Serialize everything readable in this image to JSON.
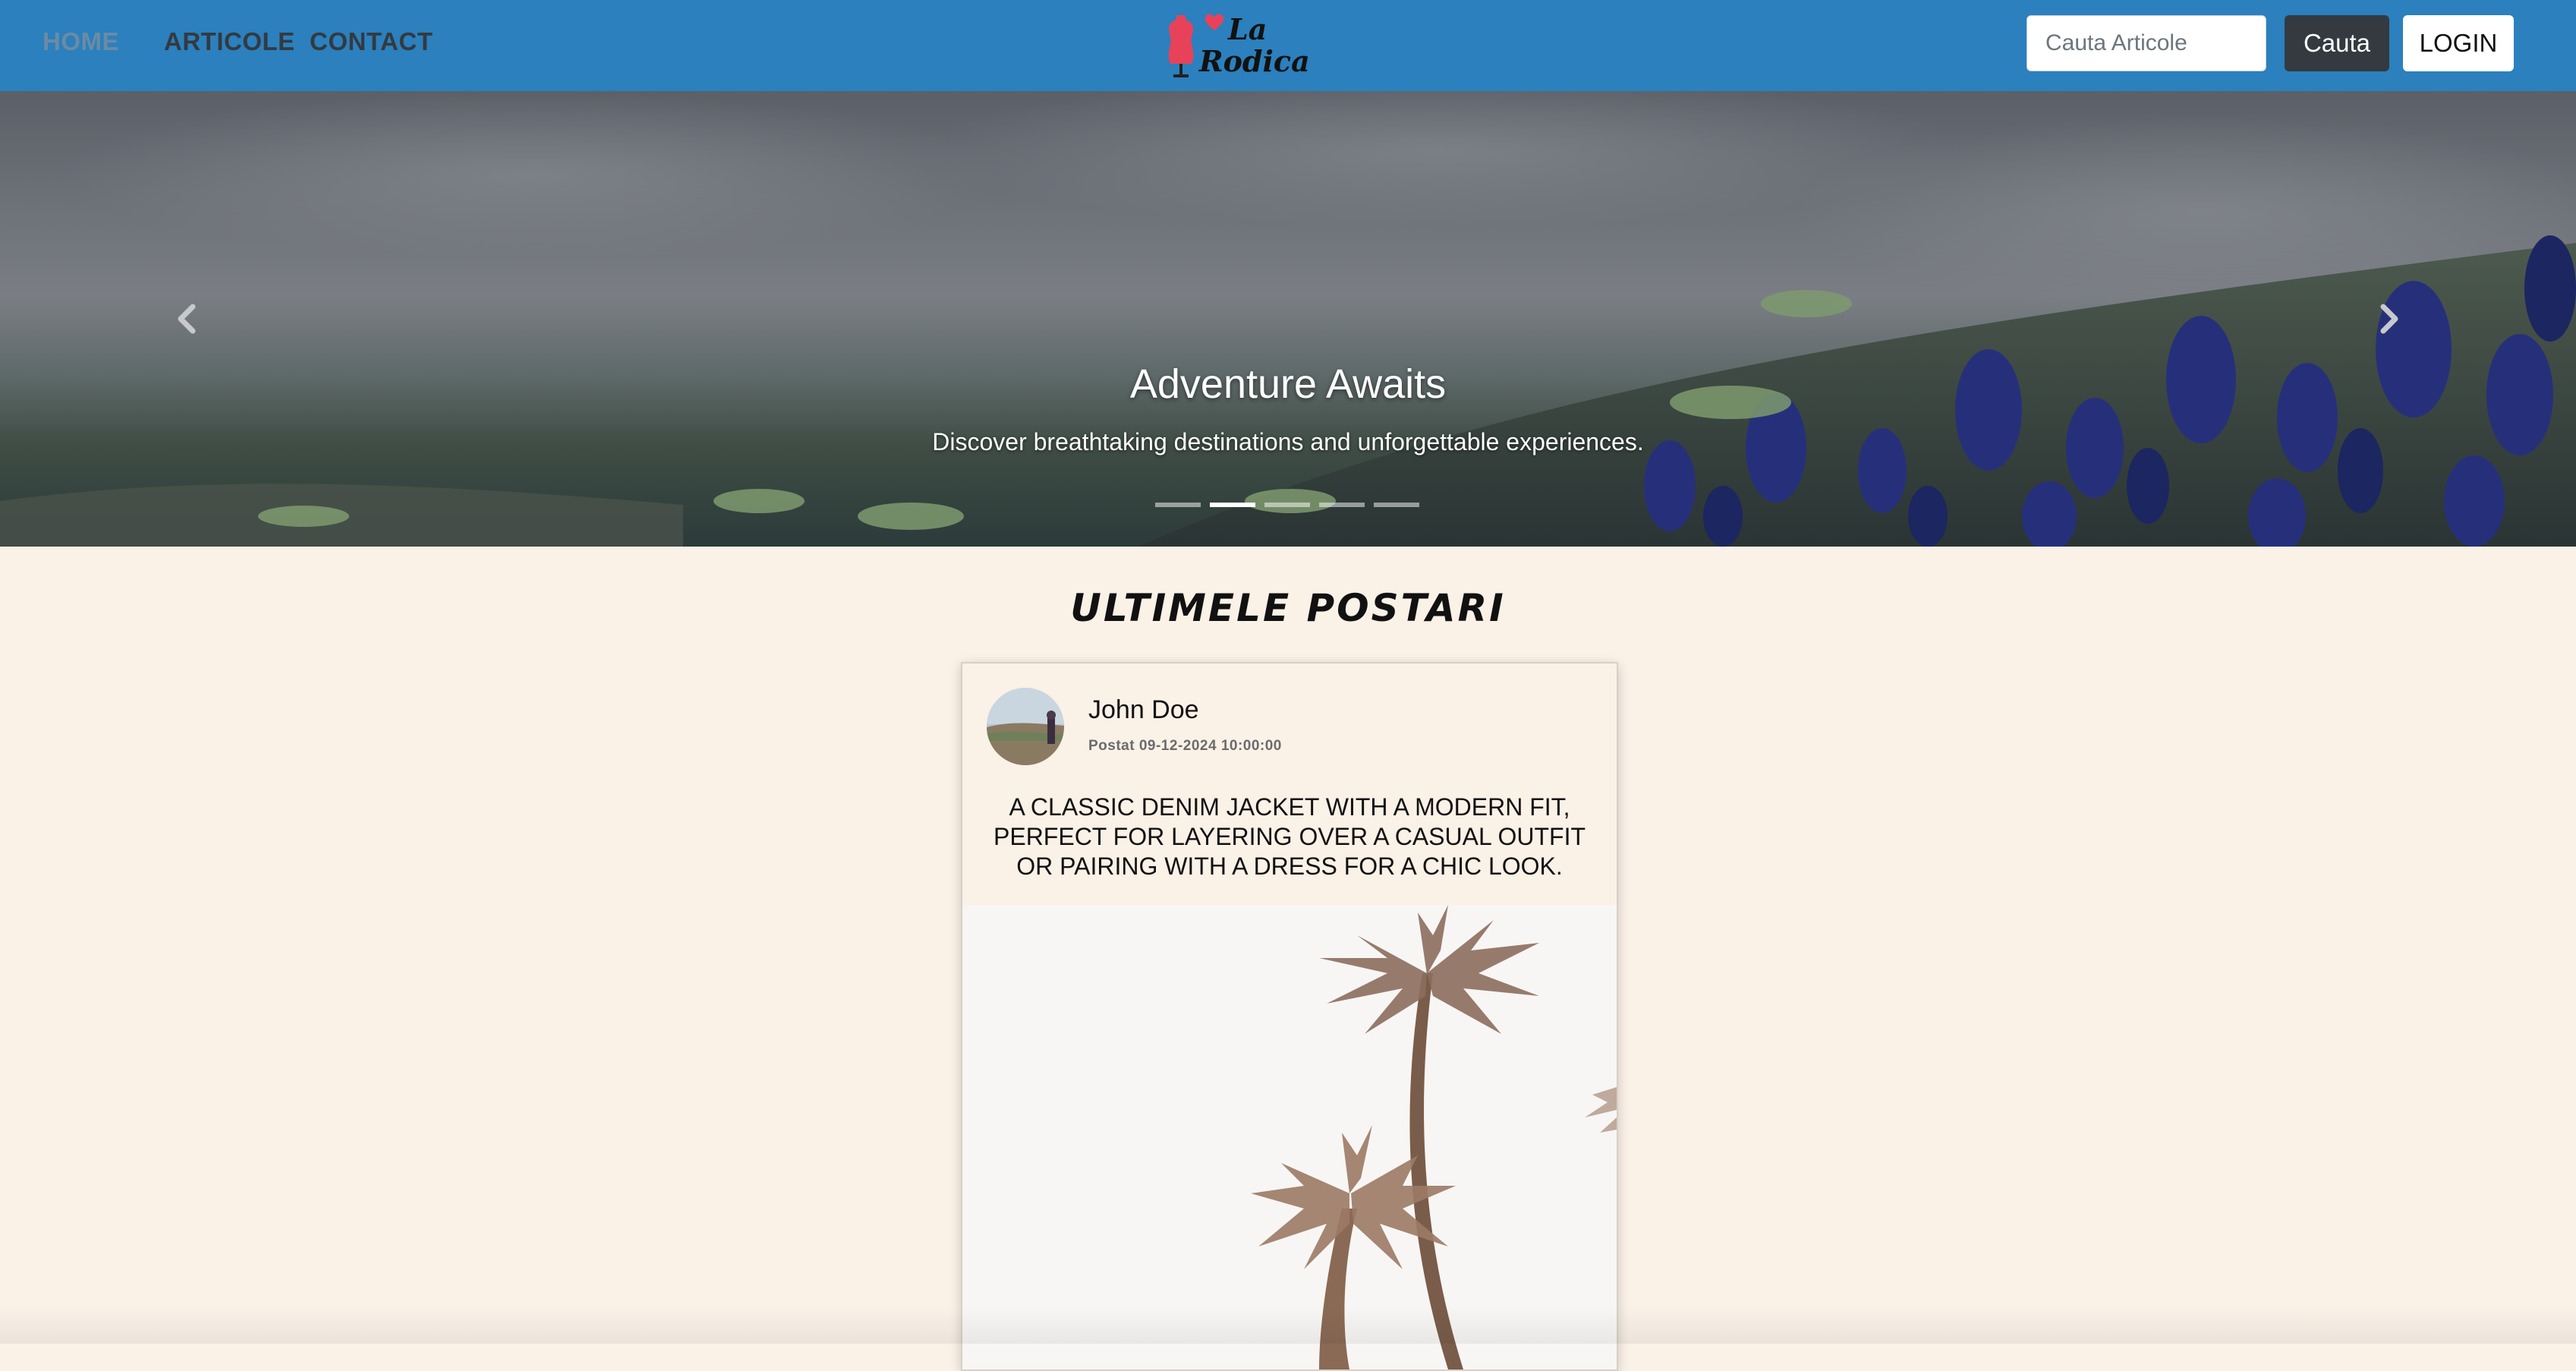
{
  "nav": {
    "links": [
      {
        "label": "HOME",
        "active": true
      },
      {
        "label": "ARTICOLE",
        "active": false
      },
      {
        "label": "CONTACT",
        "active": false
      }
    ],
    "logo": {
      "line1": "La",
      "line2": "Rodica",
      "icons": [
        "dress-form-icon",
        "heart-icon"
      ]
    },
    "search": {
      "placeholder": "Cauta Articole",
      "value": "",
      "button_label": "Cauta"
    },
    "login_label": "LOGIN",
    "colors": {
      "navbar_bg": "#2b80bd",
      "link": "#333a40",
      "active_link": "#6b8ba4",
      "search_button": "#343a40"
    }
  },
  "hero": {
    "title": "Adventure Awaits",
    "subtitle": "Discover breathtaking destinations and unforgettable experiences.",
    "slide_count": 5,
    "active_slide": 1,
    "icons": {
      "prev": "chevron-left-icon",
      "next": "chevron-right-icon"
    }
  },
  "section": {
    "title": "ULTIMELE POSTARI"
  },
  "posts": [
    {
      "author": "John Doe",
      "date": "Postat 09-12-2024 10:00:00",
      "title": "A CLASSIC DENIM JACKET WITH A MODERN FIT, PERFECT FOR LAYERING OVER A CASUAL OUTFIT OR PAIRING WITH A DRESS FOR A CHIC LOOK."
    }
  ],
  "colors": {
    "page_bg": "#faf1e7"
  }
}
